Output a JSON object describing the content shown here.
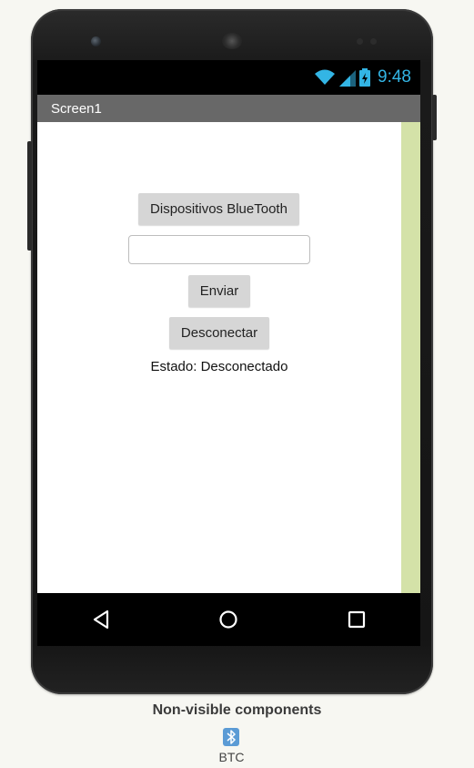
{
  "status_bar": {
    "time": "9:48"
  },
  "screen": {
    "title": "Screen1",
    "buttons": {
      "bluetooth_devices": "Dispositivos BlueTooth",
      "send": "Enviar",
      "disconnect": "Desconectar"
    },
    "text_input": {
      "value": "",
      "placeholder": ""
    },
    "status_label": "Estado: Desconectado"
  },
  "nonvisible": {
    "heading": "Non-visible components",
    "items": [
      {
        "label": "BTC",
        "icon": "bluetooth-icon"
      }
    ]
  },
  "colors": {
    "status_accent": "#33b5e5",
    "title_bar": "#686868",
    "scroll_track": "#d4e2a8",
    "button_bg": "#d6d6d6"
  }
}
